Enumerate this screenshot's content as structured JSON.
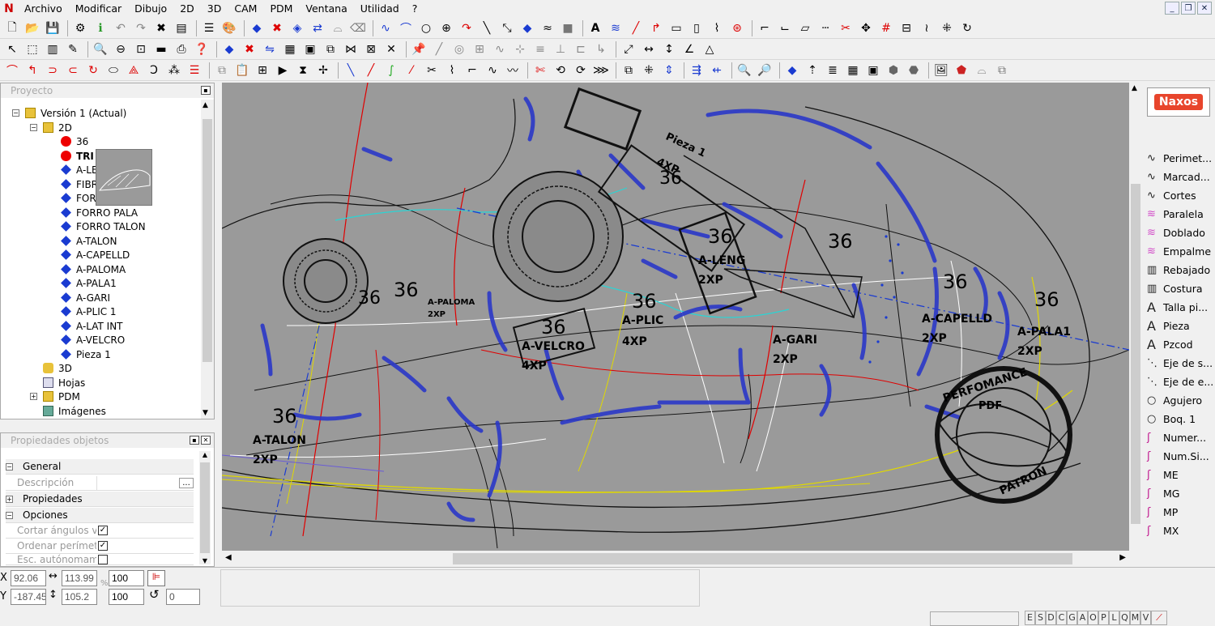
{
  "menu": [
    "Archivo",
    "Modificar",
    "Dibujo",
    "2D",
    "3D",
    "CAM",
    "PDM",
    "Ventana",
    "Utilidad",
    "?"
  ],
  "project_panel": {
    "title": "Proyecto",
    "items": [
      {
        "label": "Versión 1 (Actual)",
        "marker": "folder-cube"
      },
      {
        "label": "2D",
        "marker": "folder-2d"
      },
      {
        "label": "36",
        "marker": "red"
      },
      {
        "label": "TRI",
        "marker": "red"
      },
      {
        "label": "A-LEN",
        "marker": "blue"
      },
      {
        "label": "FIBR",
        "marker": "blue"
      },
      {
        "label": "FOR",
        "marker": "blue"
      },
      {
        "label": "FORRO PALA",
        "marker": "blue"
      },
      {
        "label": "FORRO TALON",
        "marker": "blue"
      },
      {
        "label": "A-TALON",
        "marker": "blue"
      },
      {
        "label": "A-CAPELLD",
        "marker": "blue"
      },
      {
        "label": "A-PALOMA",
        "marker": "blue"
      },
      {
        "label": "A-PALA1",
        "marker": "blue"
      },
      {
        "label": "A-GARI",
        "marker": "blue"
      },
      {
        "label": "A-PLIC 1",
        "marker": "blue"
      },
      {
        "label": "A-LAT INT",
        "marker": "blue"
      },
      {
        "label": "A-VELCRO",
        "marker": "blue"
      },
      {
        "label": "Pieza 1",
        "marker": "blue"
      },
      {
        "label": "3D",
        "marker": "3d"
      },
      {
        "label": "Hojas",
        "marker": "sheet"
      },
      {
        "label": "PDM",
        "marker": "folder"
      },
      {
        "label": "Imágenes",
        "marker": "image"
      }
    ]
  },
  "properties_panel": {
    "title": "Propiedades objetos",
    "general": "General",
    "descripcion_label": "Descripción",
    "propiedades": "Propiedades",
    "opciones": "Opciones",
    "cortar": "Cortar ángulos vivo",
    "ordenar": "Ordenar perímetro",
    "esc": "Esc. autónomame"
  },
  "canvas_labels": {
    "n36": "36",
    "a_talon": "A-TALON",
    "a_paloma": "A-PALOMA",
    "a_velcro": "A-VELCRO",
    "a_plic": "A-PLIC",
    "a_leng": "A-LENG",
    "a_gari": "A-GARI",
    "a_capelld": "A-CAPELLD",
    "a_pala1": "A-PALA1",
    "xp2": "2XP",
    "xp4": "4XP",
    "pieza1": "Pieza 1",
    "stamp_top": "PERFOMANCE",
    "stamp_mid": "PDF",
    "stamp_bottom": "PATRON"
  },
  "right_tools": {
    "brand": "Naxos",
    "items": [
      "Perimet...",
      "Marcad...",
      "Cortes",
      "Paralela",
      "Doblado",
      "Empalme",
      "Rebajado",
      "Costura",
      "Talla pi...",
      "Pieza",
      "Pzcod",
      "Eje de s...",
      "Eje de e...",
      "Agujero",
      "Boq. 1",
      "Numer...",
      "Num.Si...",
      "ME",
      "MG",
      "MP",
      "MX"
    ]
  },
  "status": {
    "x_label": "X",
    "y_label": "Y",
    "x": "92.06",
    "y": "-187.45",
    "w": "113.99",
    "h": "105.2",
    "pct_label": "%",
    "scale1": "100",
    "scale2": "100",
    "angle": "0",
    "modes": [
      "E",
      "S",
      "D",
      "C",
      "G",
      "A",
      "O",
      "P",
      "L",
      "Q",
      "M",
      "V"
    ]
  },
  "colors": {
    "canvas": "#9a9a9a",
    "accent_red": "#e00000",
    "accent_blue": "#1a3bd1"
  }
}
